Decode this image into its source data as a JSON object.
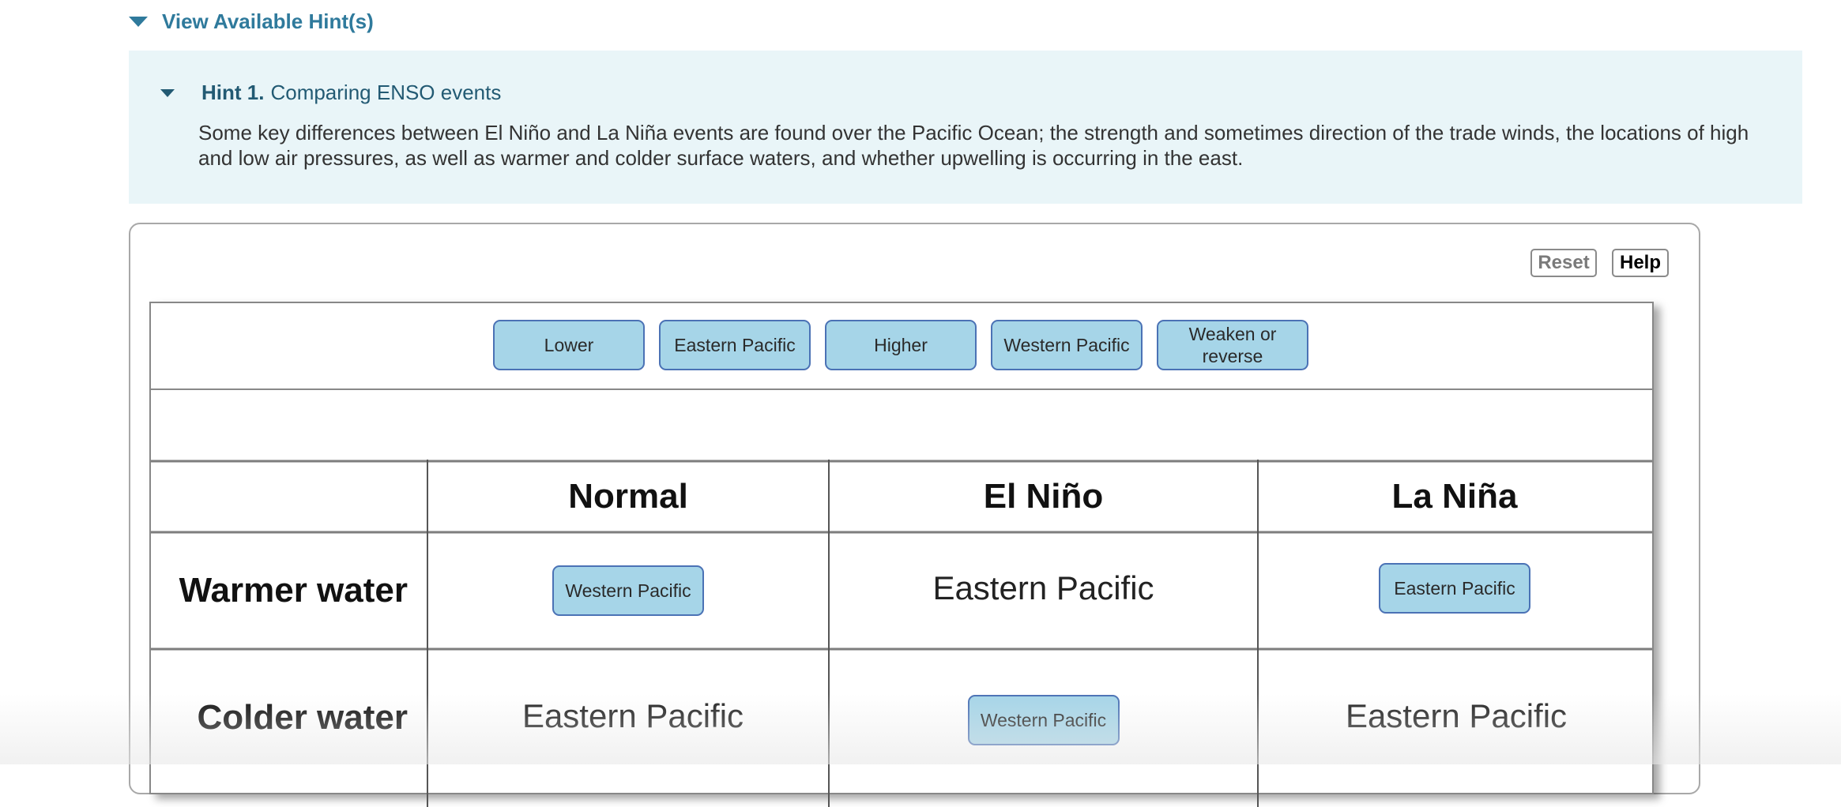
{
  "hints": {
    "toggle_label": "View Available Hint(s)",
    "items": [
      {
        "number": "Hint 1.",
        "title": "Comparing ENSO events",
        "body": "Some key differences between El Niño and La Niña events are found over the Pacific Ocean; the strength and sometimes direction of the trade winds, the locations of high and low air pressures, as well as warmer and colder surface waters, and whether upwelling is occurring in the east."
      }
    ]
  },
  "toolbar": {
    "reset_label": "Reset",
    "help_label": "Help"
  },
  "label_bank": [
    "Lower",
    "Eastern Pacific",
    "Higher",
    "Western Pacific",
    "Weaken or reverse"
  ],
  "table": {
    "columns": [
      "Normal",
      "El Niño",
      "La Niña"
    ],
    "rows": [
      {
        "label": "Warmer water",
        "cells": [
          {
            "value": "Western Pacific",
            "kind": "placed-label"
          },
          {
            "value": "Eastern Pacific",
            "kind": "given"
          },
          {
            "value": "Eastern Pacific",
            "kind": "placed-label"
          }
        ]
      },
      {
        "label": "Colder water",
        "cells": [
          {
            "value": "Eastern Pacific",
            "kind": "given"
          },
          {
            "value": "Western Pacific",
            "kind": "placed-label"
          },
          {
            "value": "Eastern Pacific",
            "kind": "given"
          }
        ]
      }
    ]
  },
  "colors": {
    "accent": "#2f7a9c",
    "hint_bg": "#e9f5f8",
    "chip_fill": "#a6d5e8",
    "chip_border": "#4b72b5"
  }
}
